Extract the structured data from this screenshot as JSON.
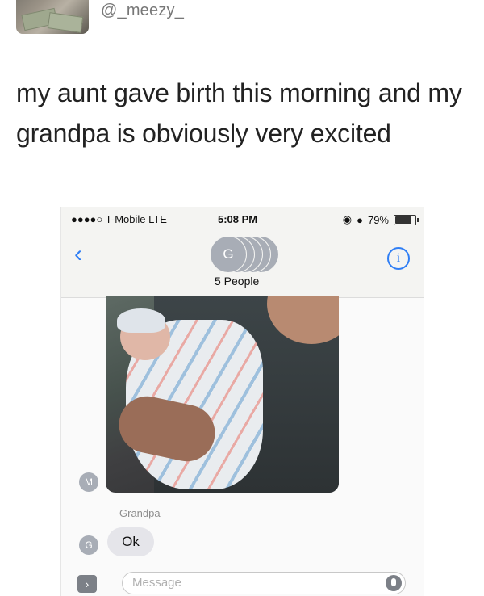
{
  "tweet": {
    "handle": "@_meezy_",
    "text": "my aunt gave birth this morning and my grandpa is obviously very excited"
  },
  "phone": {
    "status": {
      "carrier": "●●●●○ T-Mobile  LTE",
      "time": "5:08 PM",
      "battery": "79%"
    },
    "nav": {
      "back_icon": "chevron-left-icon",
      "group_letter": "G",
      "people": "5 People",
      "info_icon": "info-icon",
      "info_glyph": "i"
    },
    "messages": {
      "photo_sender_initial": "M",
      "sender": "Grandpa",
      "reply_initial": "G",
      "reply": "Ok"
    },
    "input": {
      "placeholder": "Message",
      "expand_glyph": "›"
    }
  }
}
